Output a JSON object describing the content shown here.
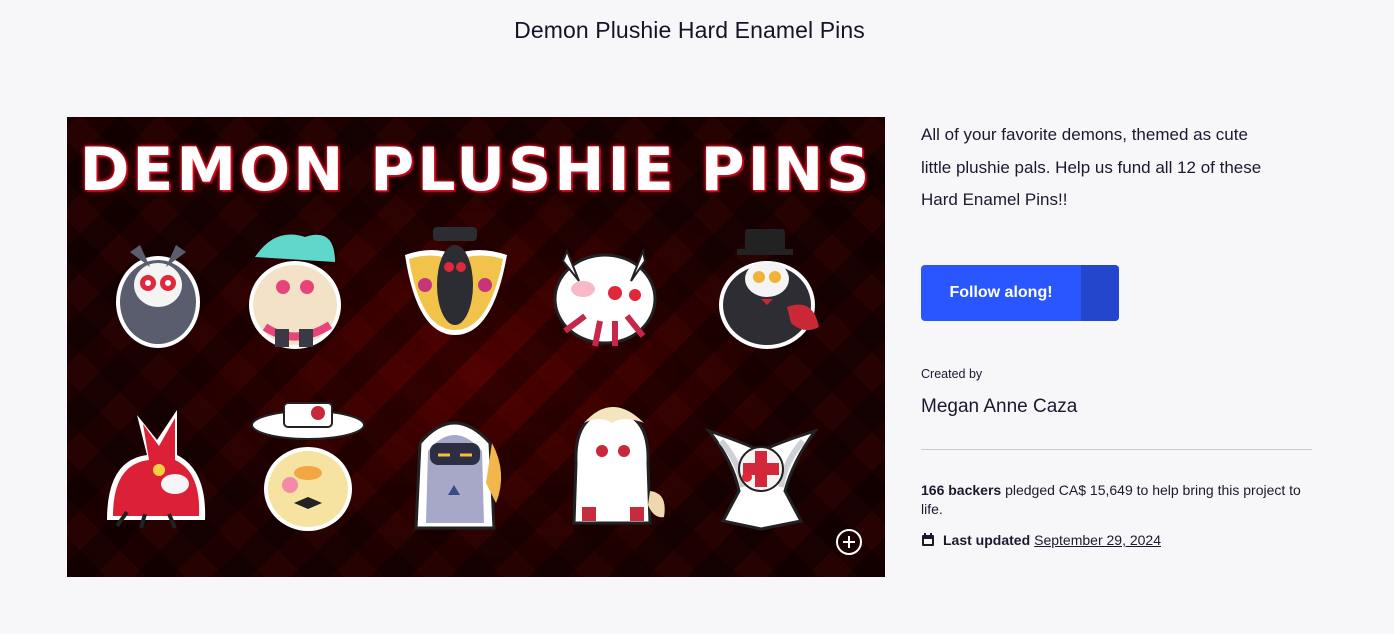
{
  "page": {
    "title": "Demon Plushie Hard Enamel Pins"
  },
  "hero": {
    "banner_text": "DEMON PLUSHIE PINS",
    "mascots": [
      "owl-demon-pin-icon",
      "rainbow-cat-pin-icon",
      "moth-demon-pin-icon",
      "white-spider-pin-icon",
      "black-cat-pin-icon",
      "red-fox-pin-icon",
      "duck-pin-icon",
      "hooded-knight-pin-icon",
      "cream-goat-pin-icon",
      "moth-nurse-pin-icon"
    ],
    "zoom_icon": "zoom-in-icon",
    "colors": {
      "background": "#1c0000",
      "accent": "#ff2a3a"
    }
  },
  "side": {
    "blurb": "All of your favorite demons, themed as cute little plushie pals. Help us fund all 12 of these Hard Enamel Pins!!",
    "follow_label": "Follow along!",
    "follow_color": "#2a56ff",
    "created_label": "Created by",
    "creator": "Megan Anne Caza",
    "stats": {
      "backers": "166 backers",
      "pledge_text": "pledged CA$ 15,649 to help bring this project to life."
    },
    "updated": {
      "icon": "calendar-icon",
      "label": "Last updated",
      "date": "September 29, 2024"
    }
  }
}
